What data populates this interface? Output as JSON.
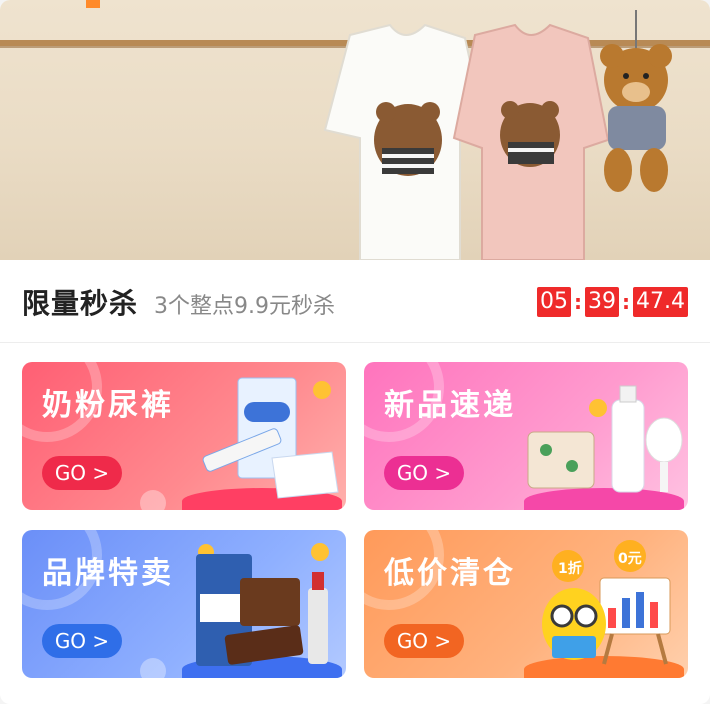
{
  "seckill": {
    "title": "限量秒杀",
    "subtitle": "3个整点9.9元秒杀",
    "countdown": {
      "hours": "05",
      "minutes": "39",
      "seconds": "47.4"
    }
  },
  "tiles": [
    {
      "label": "奶粉尿裤",
      "button": "GO >"
    },
    {
      "label": "新品速递",
      "button": "GO >"
    },
    {
      "label": "品牌特卖",
      "button": "GO >"
    },
    {
      "label": "低价清仓",
      "button": "GO >"
    }
  ],
  "tile_badges": {
    "discount": "1折",
    "zero_price": "0元"
  },
  "colors": {
    "countdown_bg": "#ef2a2a",
    "tile1_bg": "#ff6f7d",
    "tile1_go": "#ef2a4a",
    "tile2_bg": "#ff86c6",
    "tile2_go": "#ec2f93",
    "tile3_bg": "#7da0ff",
    "tile3_go": "#2f6ee8",
    "tile4_bg": "#ff9b66",
    "tile4_go": "#f26522"
  }
}
